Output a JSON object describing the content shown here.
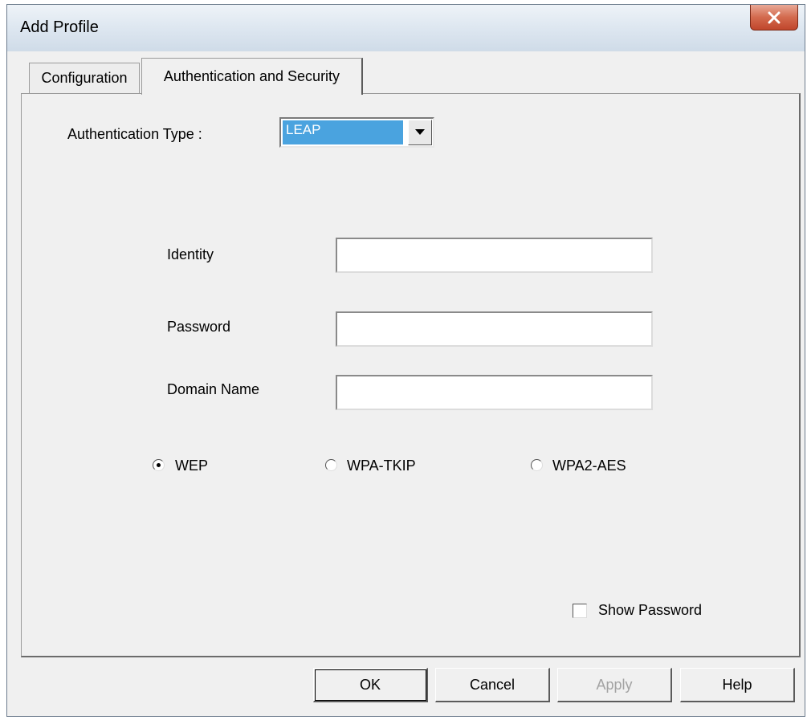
{
  "window": {
    "title": "Add Profile"
  },
  "tabs": [
    {
      "label": "Configuration",
      "active": false
    },
    {
      "label": "Authentication and Security",
      "active": true
    }
  ],
  "auth": {
    "type_label": "Authentication Type :",
    "type_value": "LEAP"
  },
  "fields": {
    "identity_label": "Identity",
    "identity_value": "",
    "password_label": "Password",
    "password_value": "",
    "domain_label": "Domain Name",
    "domain_value": ""
  },
  "encryption": {
    "options": [
      {
        "label": "WEP",
        "selected": true
      },
      {
        "label": "WPA-TKIP",
        "selected": false
      },
      {
        "label": "WPA2-AES",
        "selected": false
      }
    ]
  },
  "show_password": {
    "label": "Show Password",
    "checked": false
  },
  "buttons": {
    "ok": "OK",
    "cancel": "Cancel",
    "apply": "Apply",
    "help": "Help"
  },
  "colors": {
    "title_gradient_top": "#eef3f8",
    "close_button": "#c0462c",
    "selection": "#4aa3df",
    "dialog_bg": "#f0f0f0"
  }
}
